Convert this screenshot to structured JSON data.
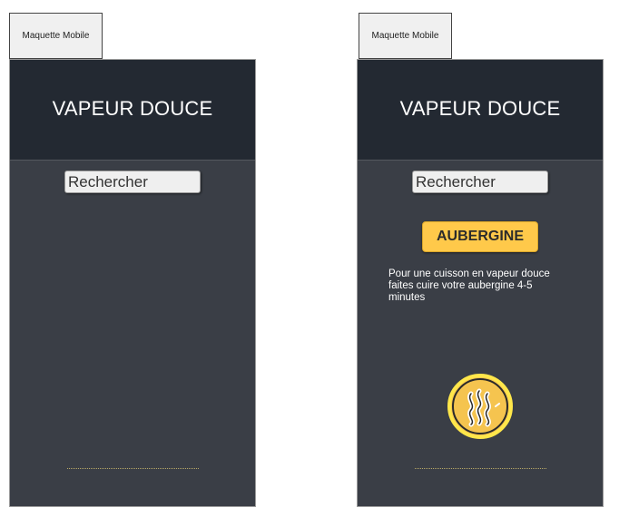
{
  "mockups": [
    {
      "tab_label": "Maquette Mobile",
      "app_title": "VAPEUR DOUCE",
      "search": {
        "placeholder": "Rechercher"
      }
    },
    {
      "tab_label": "Maquette Mobile",
      "app_title": "VAPEUR DOUCE",
      "search": {
        "placeholder": "Rechercher"
      },
      "result": {
        "vegetable": "AUBERGINE",
        "description": "Pour une cuisson en vapeur douce faites cuire votre aubergine 4-5 minutes",
        "action_icon": "steam-icon"
      }
    }
  ],
  "colors": {
    "header_bg": "#232932",
    "body_bg": "#3a3e46",
    "accent": "#ffc94a",
    "ring": "#ffe74a"
  }
}
